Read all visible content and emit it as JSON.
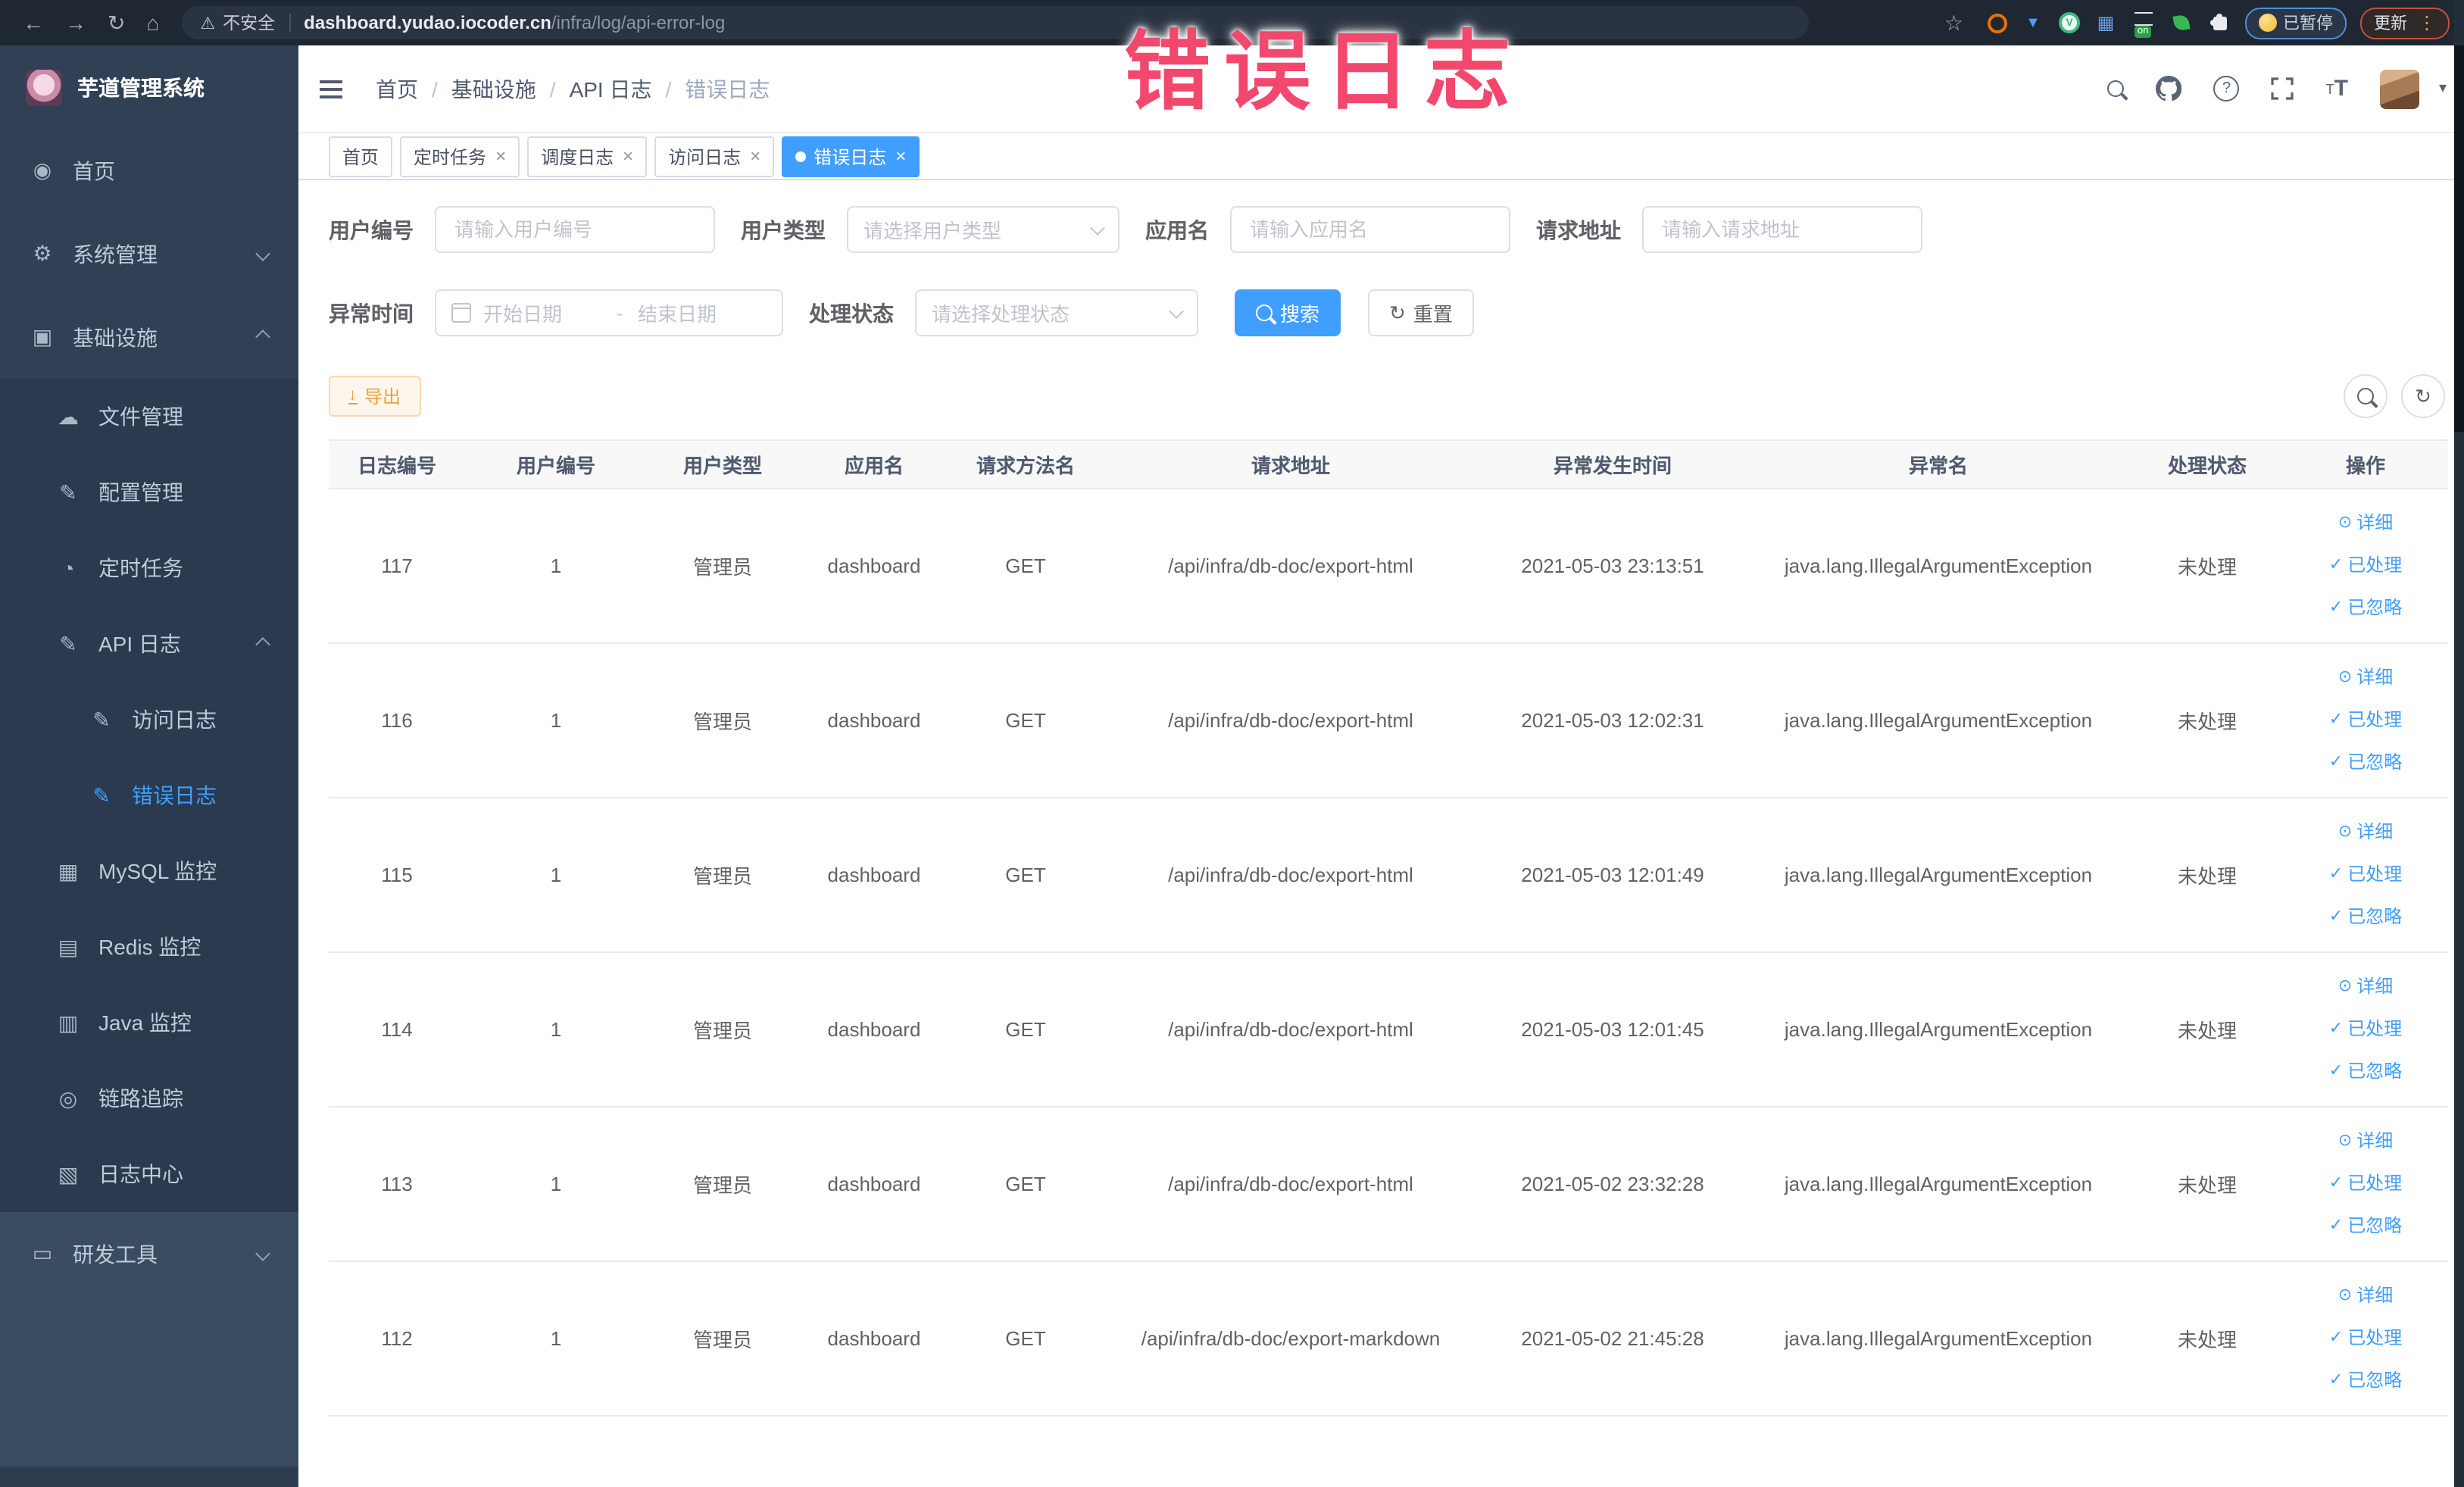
{
  "browser": {
    "security_label": "不安全",
    "url_host": "dashboard.yudao.iocoder.cn",
    "url_path": "/infra/log/api-error-log",
    "extension_toggle_label": "on",
    "paused_badge": "已暂停",
    "update_badge": "更新"
  },
  "overlay": {
    "text": "错误日志",
    "color": "#f2486d"
  },
  "sidebar": {
    "title": "芋道管理系统",
    "items": [
      {
        "key": "home",
        "label": "首页",
        "icon": "dashboard-icon",
        "level": 1
      },
      {
        "key": "system",
        "label": "系统管理",
        "icon": "gear-icon",
        "level": 1,
        "chevron": "down"
      },
      {
        "key": "infrastructure",
        "label": "基础设施",
        "icon": "monitor-icon",
        "level": 1,
        "chevron": "up"
      },
      {
        "key": "file",
        "label": "文件管理",
        "icon": "cloud-upload-icon",
        "level": 2
      },
      {
        "key": "config",
        "label": "配置管理",
        "icon": "edit-icon",
        "level": 2
      },
      {
        "key": "job",
        "label": "定时任务",
        "icon": "clock-icon",
        "level": 2
      },
      {
        "key": "api-log",
        "label": "API 日志",
        "icon": "document-edit-icon",
        "level": 2,
        "chevron": "up"
      },
      {
        "key": "access-log",
        "label": "访问日志",
        "icon": "document-edit-icon",
        "level": 3
      },
      {
        "key": "error-log",
        "label": "错误日志",
        "icon": "document-edit-icon",
        "level": 3,
        "active": true
      },
      {
        "key": "mysql",
        "label": "MySQL 监控",
        "icon": "mysql-icon",
        "level": 2
      },
      {
        "key": "redis",
        "label": "Redis 监控",
        "icon": "redis-icon",
        "level": 2
      },
      {
        "key": "java",
        "label": "Java 监控",
        "icon": "java-icon",
        "level": 2
      },
      {
        "key": "tracer",
        "label": "链路追踪",
        "icon": "trace-icon",
        "level": 2
      },
      {
        "key": "log-center",
        "label": "日志中心",
        "icon": "log-center-icon",
        "level": 2
      },
      {
        "key": "dev-tools",
        "label": "研发工具",
        "icon": "toolbox-icon",
        "level": 1,
        "chevron": "down",
        "section": "light"
      }
    ]
  },
  "header": {
    "breadcrumbs": [
      "首页",
      "基础设施",
      "API 日志",
      "错误日志"
    ]
  },
  "tabs": [
    {
      "label": "首页",
      "closable": false
    },
    {
      "label": "定时任务",
      "closable": true
    },
    {
      "label": "调度日志",
      "closable": true
    },
    {
      "label": "访问日志",
      "closable": true
    },
    {
      "label": "错误日志",
      "closable": true,
      "active": true
    }
  ],
  "filters": {
    "user_id": {
      "label": "用户编号",
      "placeholder": "请输入用户编号"
    },
    "user_type": {
      "label": "用户类型",
      "placeholder": "请选择用户类型"
    },
    "app_name": {
      "label": "应用名",
      "placeholder": "请输入应用名"
    },
    "request_url": {
      "label": "请求地址",
      "placeholder": "请输入请求地址"
    },
    "exception_time": {
      "label": "异常时间",
      "start_placeholder": "开始日期",
      "separator": "-",
      "end_placeholder": "结束日期"
    },
    "process_status": {
      "label": "处理状态",
      "placeholder": "请选择处理状态"
    },
    "search_label": "搜索",
    "reset_label": "重置"
  },
  "toolbar": {
    "export_label": "导出"
  },
  "table": {
    "columns": [
      "日志编号",
      "用户编号",
      "用户类型",
      "应用名",
      "请求方法名",
      "请求地址",
      "异常发生时间",
      "异常名",
      "处理状态",
      "操作"
    ],
    "rows": [
      {
        "id": "117",
        "user_id": "1",
        "user_type": "管理员",
        "app": "dashboard",
        "method": "GET",
        "url": "/api/infra/db-doc/export-html",
        "time": "2021-05-03 23:13:51",
        "exception": "java.lang.IllegalArgumentException",
        "status": "未处理"
      },
      {
        "id": "116",
        "user_id": "1",
        "user_type": "管理员",
        "app": "dashboard",
        "method": "GET",
        "url": "/api/infra/db-doc/export-html",
        "time": "2021-05-03 12:02:31",
        "exception": "java.lang.IllegalArgumentException",
        "status": "未处理"
      },
      {
        "id": "115",
        "user_id": "1",
        "user_type": "管理员",
        "app": "dashboard",
        "method": "GET",
        "url": "/api/infra/db-doc/export-html",
        "time": "2021-05-03 12:01:49",
        "exception": "java.lang.IllegalArgumentException",
        "status": "未处理"
      },
      {
        "id": "114",
        "user_id": "1",
        "user_type": "管理员",
        "app": "dashboard",
        "method": "GET",
        "url": "/api/infra/db-doc/export-html",
        "time": "2021-05-03 12:01:45",
        "exception": "java.lang.IllegalArgumentException",
        "status": "未处理"
      },
      {
        "id": "113",
        "user_id": "1",
        "user_type": "管理员",
        "app": "dashboard",
        "method": "GET",
        "url": "/api/infra/db-doc/export-html",
        "time": "2021-05-02 23:32:28",
        "exception": "java.lang.IllegalArgumentException",
        "status": "未处理"
      },
      {
        "id": "112",
        "user_id": "1",
        "user_type": "管理员",
        "app": "dashboard",
        "method": "GET",
        "url": "/api/infra/db-doc/export-markdown",
        "time": "2021-05-02 21:45:28",
        "exception": "java.lang.IllegalArgumentException",
        "status": "未处理"
      }
    ],
    "row_actions": [
      "详细",
      "已处理",
      "已忽略"
    ]
  },
  "colors": {
    "accent": "#409eff",
    "warning": "#e6a23c",
    "sidebar_bg": "#304156",
    "overlay_red": "#f2486d",
    "chrome_bg": "#1e2732"
  }
}
